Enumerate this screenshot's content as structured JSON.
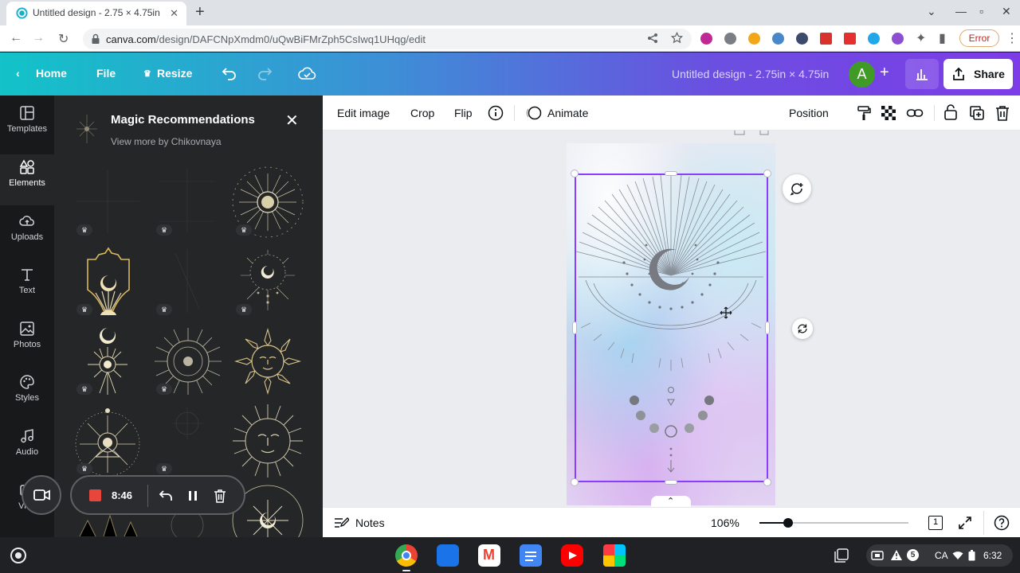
{
  "browser": {
    "tab_title": "Untitled design - 2.75 × 4.75in",
    "new_tab_label": "+",
    "url_host": "canva.com",
    "url_path": "/design/DAFCNpXmdm0/uQwBiFMrZph5CsIwq1UHqg/edit",
    "error_label": "Error"
  },
  "header": {
    "home_label": "Home",
    "file_label": "File",
    "resize_label": "Resize",
    "doc_title": "Untitled design - 2.75in × 4.75in",
    "avatar_letter": "A",
    "share_label": "Share",
    "brand_gradient": [
      "#12c3c8",
      "#3d8fd6",
      "#7d3ce8"
    ]
  },
  "rail": {
    "items": [
      {
        "label": "Templates",
        "icon": "templates-icon"
      },
      {
        "label": "Elements",
        "icon": "elements-icon"
      },
      {
        "label": "Uploads",
        "icon": "uploads-icon"
      },
      {
        "label": "Text",
        "icon": "text-icon"
      },
      {
        "label": "Photos",
        "icon": "photos-icon"
      },
      {
        "label": "Styles",
        "icon": "styles-icon"
      },
      {
        "label": "Audio",
        "icon": "audio-icon"
      },
      {
        "label": "Vide",
        "icon": "video-icon"
      }
    ],
    "active": "Elements"
  },
  "panel": {
    "title": "Magic Recommendations",
    "subtitle": "View more by Chikovnaya",
    "crown_glyph": "♛"
  },
  "recorder": {
    "time": "8:46",
    "record_color": "#e8453c"
  },
  "edit_toolbar": {
    "edit_image": "Edit image",
    "crop": "Crop",
    "flip": "Flip",
    "animate": "Animate",
    "position": "Position"
  },
  "canvas": {
    "selection_color": "#8b3dff"
  },
  "bottom": {
    "notes_label": "Notes",
    "zoom_label": "106%",
    "zoom_fraction": 0.19,
    "page_number": "1"
  },
  "shelf": {
    "notification_count": "5",
    "lang": "CA",
    "clock": "6:32"
  }
}
